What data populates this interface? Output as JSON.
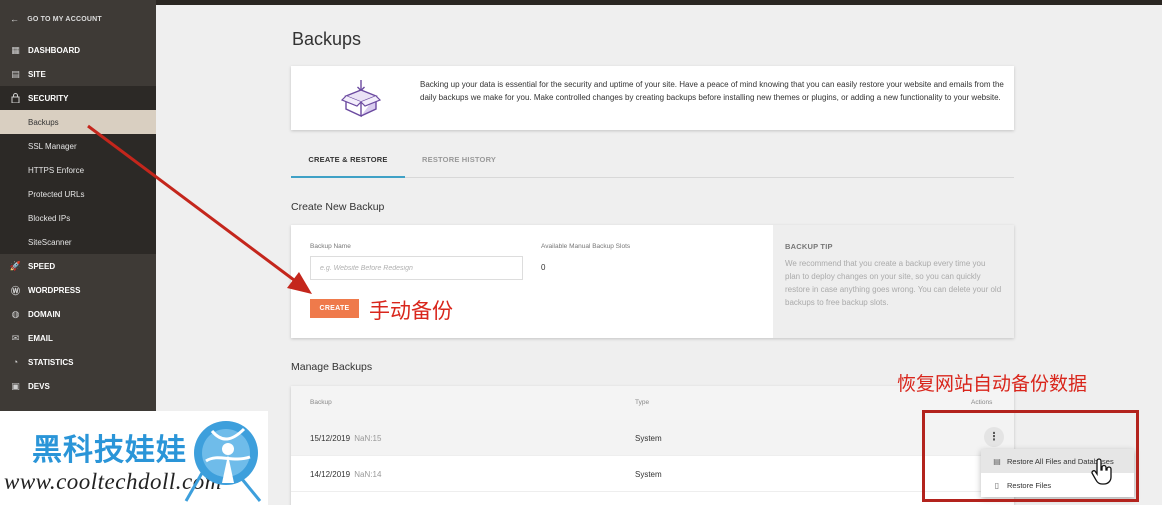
{
  "sidebar": {
    "back_label": "GO TO MY ACCOUNT",
    "items": [
      {
        "label": "DASHBOARD",
        "icon": "dashboard-icon"
      },
      {
        "label": "SITE",
        "icon": "site-icon"
      },
      {
        "label": "SECURITY",
        "icon": "lock-icon"
      },
      {
        "label": "SPEED",
        "icon": "speed-icon"
      },
      {
        "label": "WORDPRESS",
        "icon": "wordpress-icon"
      },
      {
        "label": "DOMAIN",
        "icon": "globe-icon"
      },
      {
        "label": "EMAIL",
        "icon": "email-icon"
      },
      {
        "label": "STATISTICS",
        "icon": "statistics-icon"
      },
      {
        "label": "DEVS",
        "icon": "devs-icon"
      }
    ],
    "security_sub": [
      "Backups",
      "SSL Manager",
      "HTTPS Enforce",
      "Protected URLs",
      "Blocked IPs",
      "SiteScanner"
    ]
  },
  "main": {
    "title": "Backups",
    "intro": "Backing up your data is essential for the security and uptime of your site. Have a peace of mind knowing that you can easily restore your website and emails from the daily backups we make for you. Make controlled changes by creating backups before installing new themes or plugins, or adding a new functionality to your website.",
    "tabs": [
      "CREATE & RESTORE",
      "RESTORE HISTORY"
    ],
    "create": {
      "section_title": "Create New Backup",
      "name_label": "Backup Name",
      "name_placeholder": "e.g. Website Before Redesign",
      "slots_label": "Available Manual Backup Slots",
      "slots_value": "0",
      "button_label": "CREATE",
      "tip_title": "BACKUP TIP",
      "tip_text": "We recommend that you create a backup every time you plan to deploy changes on your site, so you can quickly restore in case anything goes wrong. You can delete your old backups to free backup slots."
    },
    "manage": {
      "section_title": "Manage Backups",
      "columns": [
        "Backup",
        "Type",
        "Actions"
      ],
      "rows": [
        {
          "date": "15/12/2019",
          "time": "NaN:15",
          "type": "System"
        },
        {
          "date": "14/12/2019",
          "time": "NaN:14",
          "type": "System"
        }
      ],
      "actions_menu": [
        "Restore All Files and Databases",
        "Restore Files"
      ]
    }
  },
  "annotations": {
    "create_note": "手动备份",
    "restore_note": "恢复网站自动备份数据",
    "color": "#d9261c"
  },
  "watermark": {
    "name": "黑科技娃娃",
    "url": "www.cooltechdoll.com"
  },
  "colors": {
    "sidebar_bg": "#3e3a36",
    "accent_orange": "#ef7a4b",
    "tab_underline": "#3fa1c6",
    "active_sub_bg": "#d9cfc1"
  }
}
